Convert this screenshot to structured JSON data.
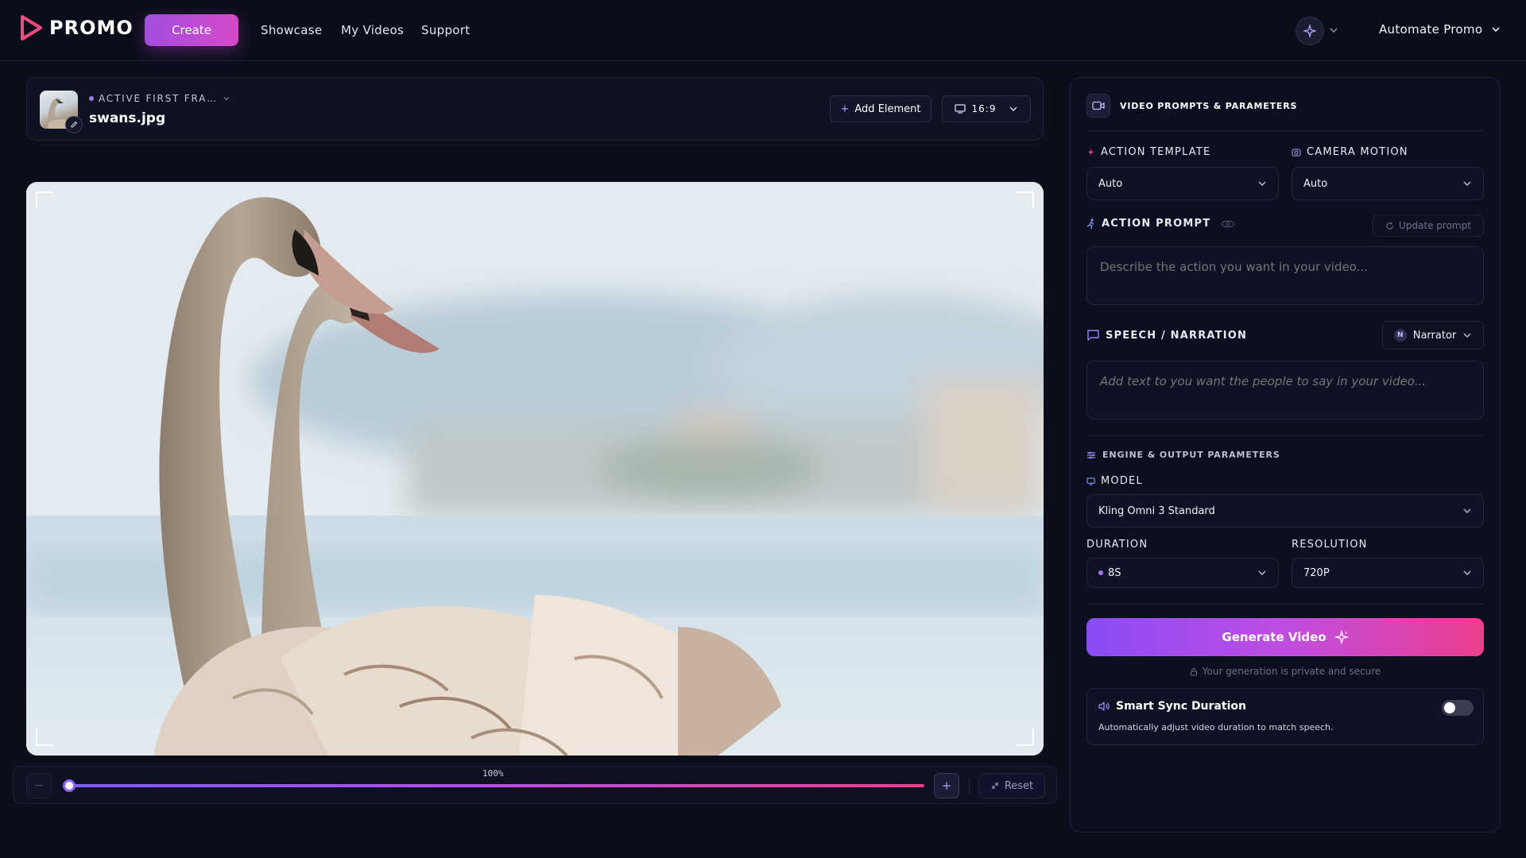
{
  "app": {
    "logo_text": "PROMO",
    "accent": "#d44ac9"
  },
  "nav": {
    "create_label": "Create",
    "links": [
      "Showcase",
      "My Videos",
      "Support"
    ],
    "account_label": "Automate Promo"
  },
  "frame": {
    "status": "ACTIVE FIRST FRA…",
    "filename": "swans.jpg",
    "add_element_label": "Add Element",
    "aspect_ratio": "16:9"
  },
  "zoom": {
    "level_label": "100%",
    "level": 0,
    "minus_label": "−",
    "plus_label": "+",
    "reset_label": "Reset"
  },
  "panel": {
    "title": "VIDEO PROMPTS & PARAMETERS",
    "action_template": {
      "label": "ACTION TEMPLATE",
      "value": "Auto"
    },
    "camera_motion": {
      "label": "CAMERA MOTION",
      "value": "Auto"
    },
    "action_prompt": {
      "label": "ACTION PROMPT",
      "update_label": "Update prompt",
      "placeholder": "Describe the action you want in your video..."
    },
    "speech": {
      "label": "SPEECH / NARRATION",
      "voice_label": "Narrator",
      "voice_badge": "N",
      "placeholder": "Add text to you want the people to say in your video..."
    },
    "engine_title": "ENGINE & OUTPUT PARAMETERS",
    "model": {
      "label": "MODEL",
      "value": "Kling Omni 3 Standard"
    },
    "duration": {
      "label": "DURATION",
      "value": "8S"
    },
    "resolution": {
      "label": "RESOLUTION",
      "value": "720P"
    },
    "generate_label": "Generate Video",
    "private_note": "Your generation is private and secure",
    "smart_sync": {
      "title": "Smart Sync Duration",
      "description": "Automatically adjust video duration to match speech.",
      "enabled": false
    }
  }
}
